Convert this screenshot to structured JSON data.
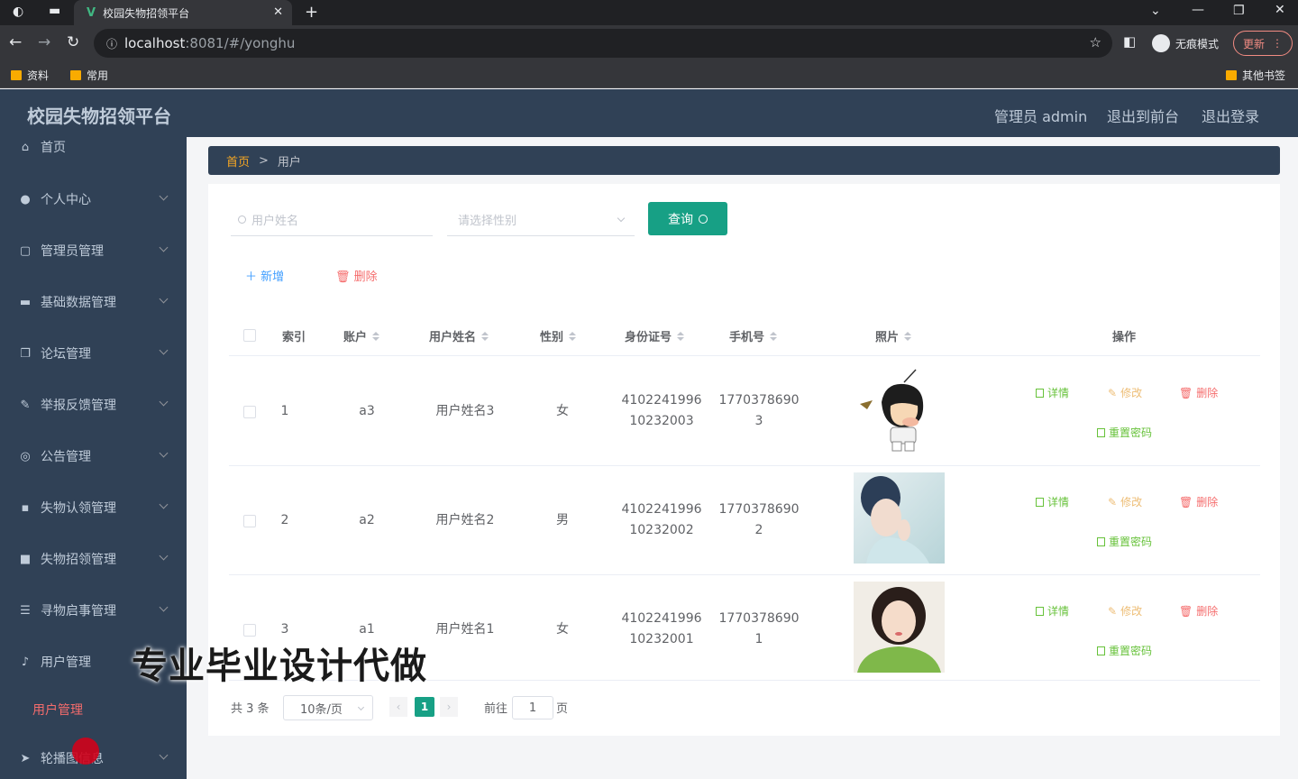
{
  "browser": {
    "tab_title": "校园失物招领平台",
    "url_host": "localhost",
    "url_path": ":8081/#/yonghu",
    "incognito_label": "无痕模式",
    "update_label": "更新",
    "bookmarks": [
      "资料",
      "常用"
    ],
    "other_bookmarks": "其他书签"
  },
  "header": {
    "title": "校园失物招领平台",
    "admin_label": "管理员 admin",
    "to_front": "退出到前台",
    "logout": "退出登录"
  },
  "sidebar": {
    "items": [
      {
        "label": "首页",
        "icon": "home-icon"
      },
      {
        "label": "个人中心",
        "icon": "user-icon"
      },
      {
        "label": "管理员管理",
        "icon": "chat-icon"
      },
      {
        "label": "基础数据管理",
        "icon": "briefcase-icon"
      },
      {
        "label": "论坛管理",
        "icon": "copy-icon"
      },
      {
        "label": "举报反馈管理",
        "icon": "edit-icon"
      },
      {
        "label": "公告管理",
        "icon": "compass-icon"
      },
      {
        "label": "失物认领管理",
        "icon": "message-icon"
      },
      {
        "label": "失物招领管理",
        "icon": "video-icon"
      },
      {
        "label": "寻物启事管理",
        "icon": "filter-icon"
      },
      {
        "label": "用户管理",
        "icon": "microphone-icon"
      },
      {
        "label": "轮播图信息",
        "icon": "send-icon"
      }
    ],
    "active_sub": "用户管理"
  },
  "breadcrumb": {
    "home": "首页",
    "current": "用户"
  },
  "search": {
    "name_placeholder": "用户姓名",
    "gender_placeholder": "请选择性别",
    "query_label": "查询"
  },
  "actions": {
    "add": "新增",
    "delete": "删除"
  },
  "table": {
    "headers": [
      "索引",
      "账户",
      "用户姓名",
      "性别",
      "身份证号",
      "手机号",
      "照片",
      "操作"
    ],
    "rows": [
      {
        "index": "1",
        "account": "a3",
        "name": "用户姓名3",
        "gender": "女",
        "id_1": "4102241996",
        "id_2": "10232003",
        "phone_1": "1770378690",
        "phone_2": "3",
        "photo": "cartoon"
      },
      {
        "index": "2",
        "account": "a2",
        "name": "用户姓名2",
        "gender": "男",
        "id_1": "4102241996",
        "id_2": "10232002",
        "phone_1": "1770378690",
        "phone_2": "2",
        "photo": "woman-blue"
      },
      {
        "index": "3",
        "account": "a1",
        "name": "用户姓名1",
        "gender": "女",
        "id_1": "4102241996",
        "id_2": "10232001",
        "phone_1": "1770378690",
        "phone_2": "1",
        "photo": "woman-green"
      }
    ],
    "op_detail": "详情",
    "op_edit": "修改",
    "op_delete": "删除",
    "op_reset": "重置密码"
  },
  "pagination": {
    "total": "共 3 条",
    "page_size": "10条/页",
    "current": "1",
    "goto": "前往",
    "page_input": "1",
    "page_suffix": "页"
  },
  "watermark": "专业毕业设计代做",
  "colors": {
    "sidebar_bg": "#304156",
    "accent": "#17a085",
    "danger": "#f56c6c",
    "success": "#67c23a",
    "warning": "#e6a23c"
  }
}
